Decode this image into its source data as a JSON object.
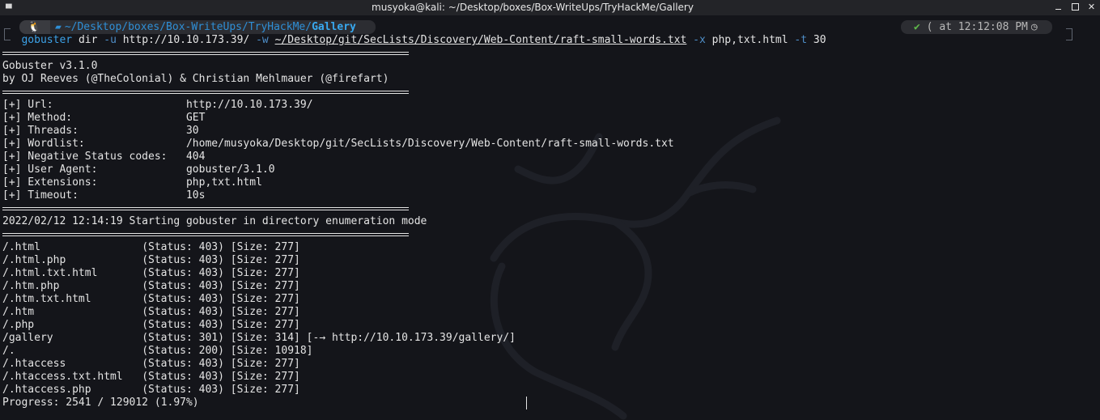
{
  "window": {
    "title": "musyoka@kali: ~/Desktop/boxes/Box-WriteUps/TryHackMe/Gallery",
    "terminal_icon": "terminal-icon"
  },
  "prompt": {
    "os_icon": "linux-penguin-icon",
    "folder_icon": "folder-icon",
    "path": "~/Desktop/boxes/Box-WriteUps/TryHackMe/",
    "path_leaf": "Gallery",
    "status_check": "✔",
    "status_prefix": "(",
    "status_time": "at 12:12:08 PM",
    "status_icon": "clock-icon"
  },
  "command": {
    "program": "gobuster",
    "subcommand": "dir",
    "flag_u": "-u",
    "url": "http://10.10.173.39/",
    "flag_w": "-w",
    "wordlist": "~/Desktop/git/SecLists/Discovery/Web-Content/raft-small-words.txt",
    "flag_x": "-x",
    "extensions": "php,txt.html",
    "flag_t": "-t",
    "threads": "30"
  },
  "banner": {
    "line1": "Gobuster v3.1.0",
    "line2": "by OJ Reeves (@TheColonial) & Christian Mehlmauer (@firefart)"
  },
  "config": [
    {
      "key": "[+] Url:",
      "value": "http://10.10.173.39/"
    },
    {
      "key": "[+] Method:",
      "value": "GET"
    },
    {
      "key": "[+] Threads:",
      "value": "30"
    },
    {
      "key": "[+] Wordlist:",
      "value": "/home/musyoka/Desktop/git/SecLists/Discovery/Web-Content/raft-small-words.txt"
    },
    {
      "key": "[+] Negative Status codes:",
      "value": "404"
    },
    {
      "key": "[+] User Agent:",
      "value": "gobuster/3.1.0"
    },
    {
      "key": "[+] Extensions:",
      "value": "php,txt.html"
    },
    {
      "key": "[+] Timeout:",
      "value": "10s"
    }
  ],
  "start_line": "2022/02/12 12:14:19 Starting gobuster in directory enumeration mode",
  "results": [
    {
      "path": "/.html",
      "status": "(Status: 403)",
      "size": "[Size: 277]",
      "extra": ""
    },
    {
      "path": "/.html.php",
      "status": "(Status: 403)",
      "size": "[Size: 277]",
      "extra": ""
    },
    {
      "path": "/.html.txt.html",
      "status": "(Status: 403)",
      "size": "[Size: 277]",
      "extra": ""
    },
    {
      "path": "/.htm.php",
      "status": "(Status: 403)",
      "size": "[Size: 277]",
      "extra": ""
    },
    {
      "path": "/.htm.txt.html",
      "status": "(Status: 403)",
      "size": "[Size: 277]",
      "extra": ""
    },
    {
      "path": "/.htm",
      "status": "(Status: 403)",
      "size": "[Size: 277]",
      "extra": ""
    },
    {
      "path": "/.php",
      "status": "(Status: 403)",
      "size": "[Size: 277]",
      "extra": ""
    },
    {
      "path": "/gallery",
      "status": "(Status: 301)",
      "size": "[Size: 314]",
      "extra": "[-→ http://10.10.173.39/gallery/]"
    },
    {
      "path": "/.",
      "status": "(Status: 200)",
      "size": "[Size: 10918]",
      "extra": ""
    },
    {
      "path": "/.htaccess",
      "status": "(Status: 403)",
      "size": "[Size: 277]",
      "extra": ""
    },
    {
      "path": "/.htaccess.txt.html",
      "status": "(Status: 403)",
      "size": "[Size: 277]",
      "extra": ""
    },
    {
      "path": "/.htaccess.php",
      "status": "(Status: 403)",
      "size": "[Size: 277]",
      "extra": ""
    }
  ],
  "progress": "Progress: 2541 / 129012 (1.97%)",
  "colors": {
    "background": "#14151a",
    "titlebar": "#232428",
    "accent": "#2f8fd6",
    "text": "#e4e4e4",
    "ok": "#5fb84a"
  }
}
